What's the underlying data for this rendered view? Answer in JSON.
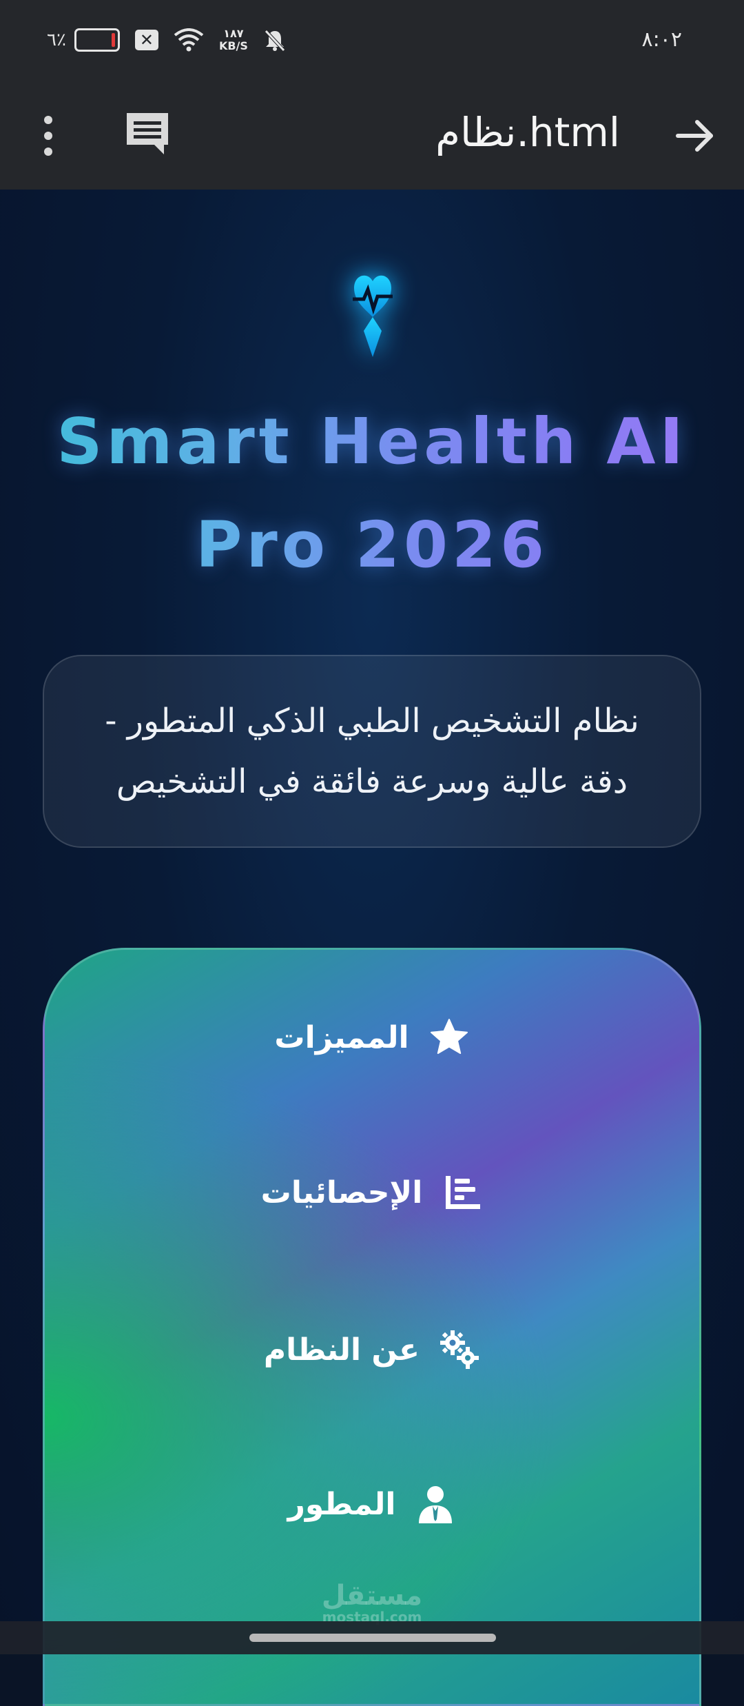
{
  "status_bar": {
    "time": "٨:٠٢",
    "battery_percent": "٦٪",
    "net_speed_value": "١٨٧",
    "net_speed_unit": "KB/S"
  },
  "app_bar": {
    "title": "نظام.html"
  },
  "hero": {
    "title_line1_a": "Smart ",
    "title_line1_b": "Health AI",
    "title_line2": "Pro 2026",
    "subtitle": "نظام التشخيص الطبي الذكي المتطور - دقة عالية وسرعة فائقة في التشخيص"
  },
  "nav": {
    "items": [
      {
        "label": "المميزات",
        "icon": "star-icon"
      },
      {
        "label": "الإحصائيات",
        "icon": "chart-icon"
      },
      {
        "label": "عن النظام",
        "icon": "gears-icon"
      },
      {
        "label": "المطور",
        "icon": "user-icon"
      }
    ]
  },
  "watermark": {
    "brand": "مستقل",
    "domain": "mostaql.com"
  },
  "colors": {
    "bar_bg": "#25272b",
    "accent_cyan": "#18b4ff",
    "title_gradient_start": "#3cbfd8",
    "title_gradient_end": "#9b7af6"
  }
}
